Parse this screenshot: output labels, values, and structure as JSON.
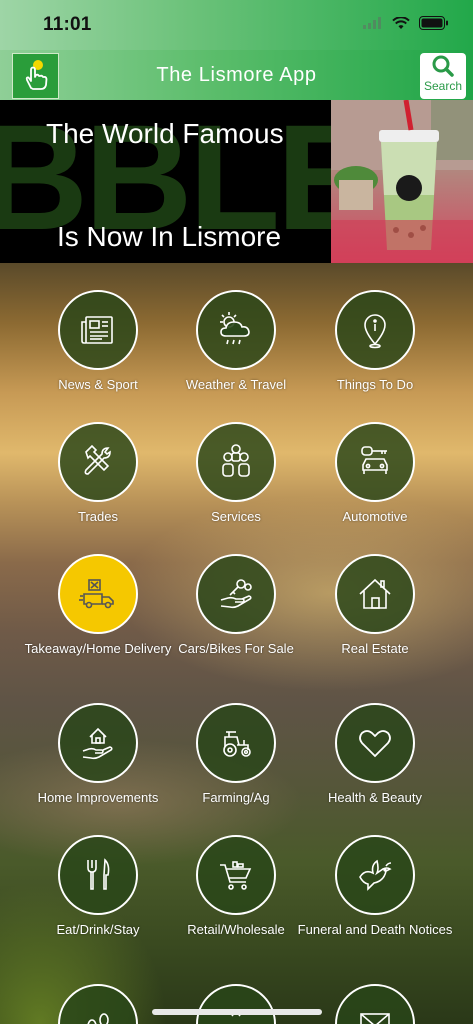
{
  "status": {
    "time": "11:01"
  },
  "header": {
    "title": "The Lismore App",
    "search_label": "Search"
  },
  "banner": {
    "line1": "The World Famous",
    "line2": "Is Now In Lismore",
    "watermark": "BBLE T"
  },
  "categories": [
    {
      "label": "News & Sport",
      "icon": "newspaper-icon"
    },
    {
      "label": "Weather & Travel",
      "icon": "weather-icon"
    },
    {
      "label": "Things To Do",
      "icon": "map-pin-icon"
    },
    {
      "label": "Trades",
      "icon": "tools-icon"
    },
    {
      "label": "Services",
      "icon": "services-icon"
    },
    {
      "label": "Automotive",
      "icon": "car-key-icon"
    },
    {
      "label": "Takeaway/Home Delivery",
      "icon": "delivery-truck-icon"
    },
    {
      "label": "Cars/Bikes For Sale",
      "icon": "hand-key-icon"
    },
    {
      "label": "Real Estate",
      "icon": "house-icon"
    },
    {
      "label": "Home Improvements",
      "icon": "hand-house-icon"
    },
    {
      "label": "Farming/Ag",
      "icon": "tractor-icon"
    },
    {
      "label": "Health & Beauty",
      "icon": "heart-icon"
    },
    {
      "label": "Eat/Drink/Stay",
      "icon": "cutlery-icon"
    },
    {
      "label": "Retail/Wholesale",
      "icon": "shopping-cart-icon"
    },
    {
      "label": "Funeral and Death Notices",
      "icon": "dove-icon"
    },
    {
      "label": "",
      "icon": "footprints-icon"
    },
    {
      "label": "",
      "icon": "partial-icon"
    },
    {
      "label": "",
      "icon": "mail-icon"
    }
  ],
  "colors": {
    "accent": "#22a84a",
    "highlight": "#f5c800"
  }
}
